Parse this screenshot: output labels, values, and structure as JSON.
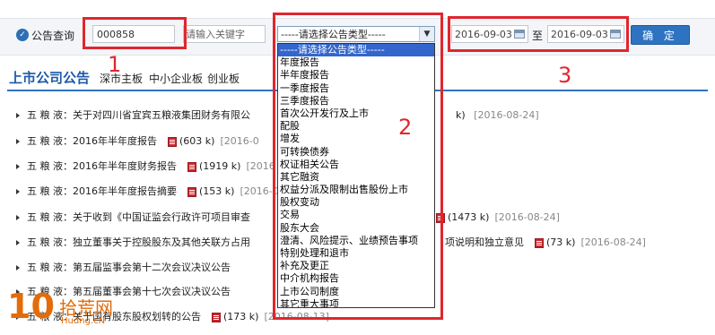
{
  "search": {
    "query_label": "公告查询",
    "code_value": "000858",
    "keyword_placeholder": "请输入关键字",
    "type_select_value": "-----请选择公告类型-----",
    "date_from": "2016-09-03",
    "to_label": "至",
    "date_to": "2016-09-03",
    "ok_label": "确 定"
  },
  "annotations": [
    "1",
    "2",
    "3"
  ],
  "section": {
    "title": "上市公司公告",
    "links": [
      "深市主板",
      "中小企业板",
      "创业板"
    ]
  },
  "rows": [
    {
      "company": "五 粮 液",
      "title": "关于对四川省宜宾五粮液集团财务有限公",
      "size": "",
      "date": "[2016-08-24]"
    },
    {
      "company": "五 粮 液",
      "title": "2016年半年度报告",
      "size": "(603 k)",
      "date": "[2016-0"
    },
    {
      "company": "五 粮 液",
      "title": "2016年半年度财务报告",
      "size": "(1919 k)",
      "date": "[2016"
    },
    {
      "company": "五 粮 液",
      "title": "2016年半年度报告摘要",
      "size": "(153 k)",
      "date": "[2016-0"
    },
    {
      "company": "五 粮 液",
      "title": "关于收到《中国证监会行政许可项目审查",
      "size": "(1473 k)",
      "date": "[2016-08-24]"
    },
    {
      "company": "五 粮 液",
      "title": "独立董事关于控股股东及其他关联方占用",
      "tail": "项说明和独立意见",
      "size": "(73 k)",
      "date": "[2016-08-24]"
    },
    {
      "company": "五 粮 液",
      "title": "第五届监事会第十二次会议决议公告",
      "size": "",
      "date": ""
    },
    {
      "company": "五 粮 液",
      "title": "第五届董事会第十七次会议决议公告",
      "size": "",
      "date": ""
    },
    {
      "company": "五 粮 液",
      "title": "关于国有股东股权划转的公告",
      "size": "(173 k)",
      "date": "[2016-08-13]"
    }
  ],
  "dropdown_options": [
    "-----请选择公告类型-----",
    "年度报告",
    "半年度报告",
    "一季度报告",
    "三季度报告",
    "首次公开发行及上市",
    "配股",
    "增发",
    "可转换债券",
    "权证相关公告",
    "其它融资",
    "权益分派及限制出售股份上市",
    "股权变动",
    "交易",
    "股东大会",
    "澄清、风险提示、业绩预告事项",
    "特别处理和退市",
    "补充及更正",
    "中介机构报告",
    "上市公司制度",
    "其它重大事项"
  ],
  "watermark": {
    "num": "10",
    "cn": "拾荒网",
    "en": "Hudng.cN"
  },
  "colors": {
    "accent": "#2e73c1",
    "annotation_red": "#e0262d",
    "selected": "#3366cc"
  }
}
